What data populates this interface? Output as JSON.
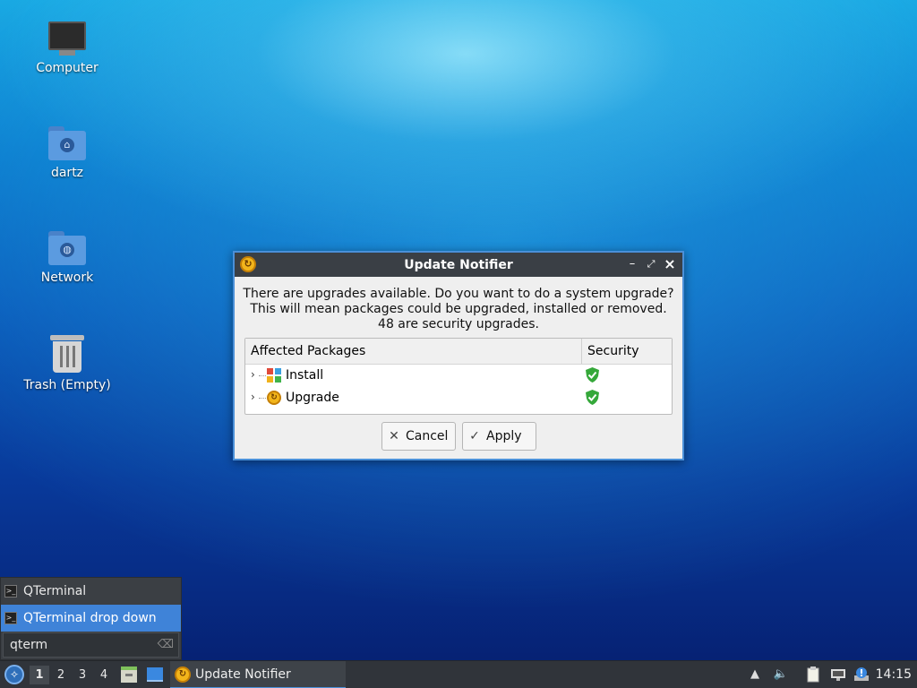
{
  "desktop": {
    "icons": [
      {
        "label": "Computer"
      },
      {
        "label": "dartz"
      },
      {
        "label": "Network"
      },
      {
        "label": "Trash (Empty)"
      }
    ]
  },
  "dialog": {
    "title": "Update Notifier",
    "message_line1": "There are upgrades available. Do you want to do a system upgrade?",
    "message_line2": "This will mean packages could be upgraded, installed or removed.",
    "message_line3": "48 are security upgrades.",
    "columns": [
      "Affected Packages",
      "Security"
    ],
    "rows": [
      {
        "name": "Install",
        "icon": "package-icon",
        "security": "shield-check-icon"
      },
      {
        "name": "Upgrade",
        "icon": "upgrade-icon",
        "security": "shield-check-icon"
      }
    ],
    "cancel_label": "Cancel",
    "apply_label": "Apply",
    "window_controls": [
      "minimize-icon",
      "maximize-icon",
      "close-icon"
    ]
  },
  "launcher": {
    "items": [
      {
        "label": "QTerminal",
        "active": false
      },
      {
        "label": "QTerminal drop down",
        "active": true
      }
    ],
    "search_value": "qterm"
  },
  "taskbar": {
    "workspaces": [
      "1",
      "2",
      "3",
      "4"
    ],
    "current_workspace": "1",
    "task_label": "Update Notifier",
    "clock": "14:15"
  },
  "colors": {
    "accent": "#4a90d9",
    "titlebar": "#3a3f45",
    "taskbar": "#30343a",
    "security_green": "#35a83a",
    "upgrade_orange": "#f2b51b"
  }
}
